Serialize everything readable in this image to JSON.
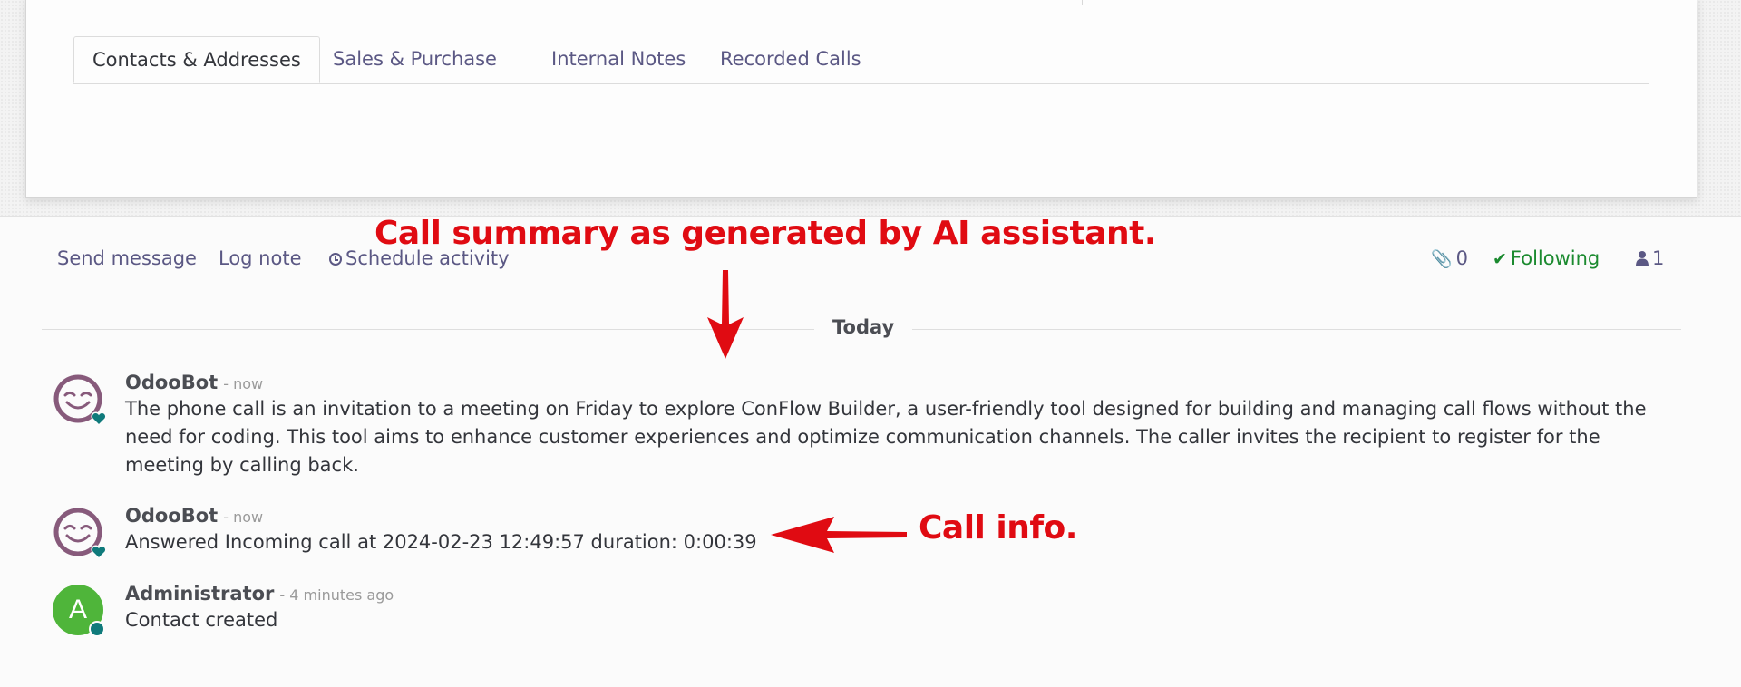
{
  "tabs": [
    {
      "label": "Contacts & Addresses",
      "active": true
    },
    {
      "label": "Sales & Purchase",
      "active": false
    },
    {
      "label": "Internal Notes",
      "active": false
    },
    {
      "label": "Recorded Calls",
      "active": false
    }
  ],
  "chatter": {
    "send_message": "Send message",
    "log_note": "Log note",
    "schedule_activity": "Schedule activity",
    "attachments_count": "0",
    "following": "Following",
    "followers_count": "1"
  },
  "day_separator": "Today",
  "messages": [
    {
      "author": "OdooBot",
      "time": "- now",
      "text": "The phone call is an invitation to a meeting on Friday to explore ConFlow Builder, a user-friendly tool designed for building and managing call flows without the need for coding. This tool aims to enhance customer experiences and optimize communication channels. The caller invites the recipient to register for the meeting by calling back.",
      "avatar_icon": "smiley-bot-icon"
    },
    {
      "author": "OdooBot",
      "time": "- now",
      "text": "Answered Incoming call at 2024-02-23 12:49:57 duration: 0:00:39",
      "avatar_icon": "smiley-bot-icon"
    },
    {
      "author": "Administrator",
      "time": "- 4 minutes ago",
      "text": "Contact created",
      "avatar_letter": "A"
    }
  ],
  "annotations": {
    "summary_note": "Call summary as generated by AI assistant.",
    "info_note": "Call info."
  },
  "colors": {
    "link": "#5b5884",
    "following": "#1b8a2f",
    "annotation": "#e00b12",
    "bot_avatar": "#875a7b",
    "status_dot": "#0f7a7b",
    "admin_avatar": "#4fb53a"
  }
}
